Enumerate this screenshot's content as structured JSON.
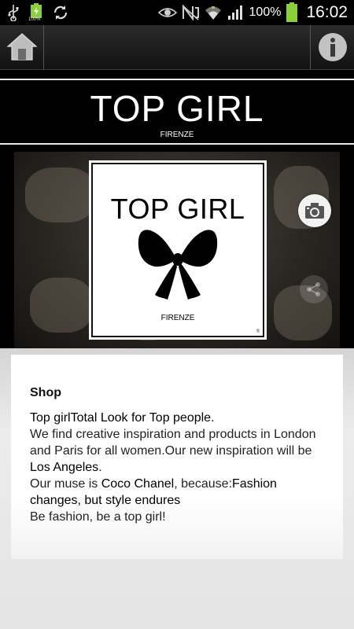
{
  "status_bar": {
    "battery_small_label": "100%",
    "battery_label": "100%",
    "time": "16:02"
  },
  "header": {
    "title": "TOP GIRL",
    "subtitle": "FIRENZE"
  },
  "logo_card": {
    "title": "TOP GIRL",
    "subtitle": "FIRENZE",
    "registered": "®"
  },
  "content": {
    "heading": "Shop",
    "line1": "Top girlTotal Look for Top people.",
    "line2a": "We find creative inspiration and products in London and Paris for all women.Our new inspiration will be ",
    "line2b": "Los Angeles",
    "line2c": ".",
    "line3a": "Our muse is ",
    "line3b": "Coco Chanel",
    "line3c": ", because:",
    "line3d": "Fashion changes, but style endures",
    "line4": "Be fashion, be a top girl!"
  },
  "icons": {
    "usb": "usb-icon",
    "battery_small": "battery-small-icon",
    "sync": "sync-icon",
    "eye": "eye-icon",
    "nfc": "nfc-icon",
    "wifi": "wifi-icon",
    "signal": "signal-icon",
    "battery": "battery-icon",
    "home": "home-icon",
    "info": "info-icon",
    "camera": "camera-icon",
    "share": "share-icon"
  }
}
